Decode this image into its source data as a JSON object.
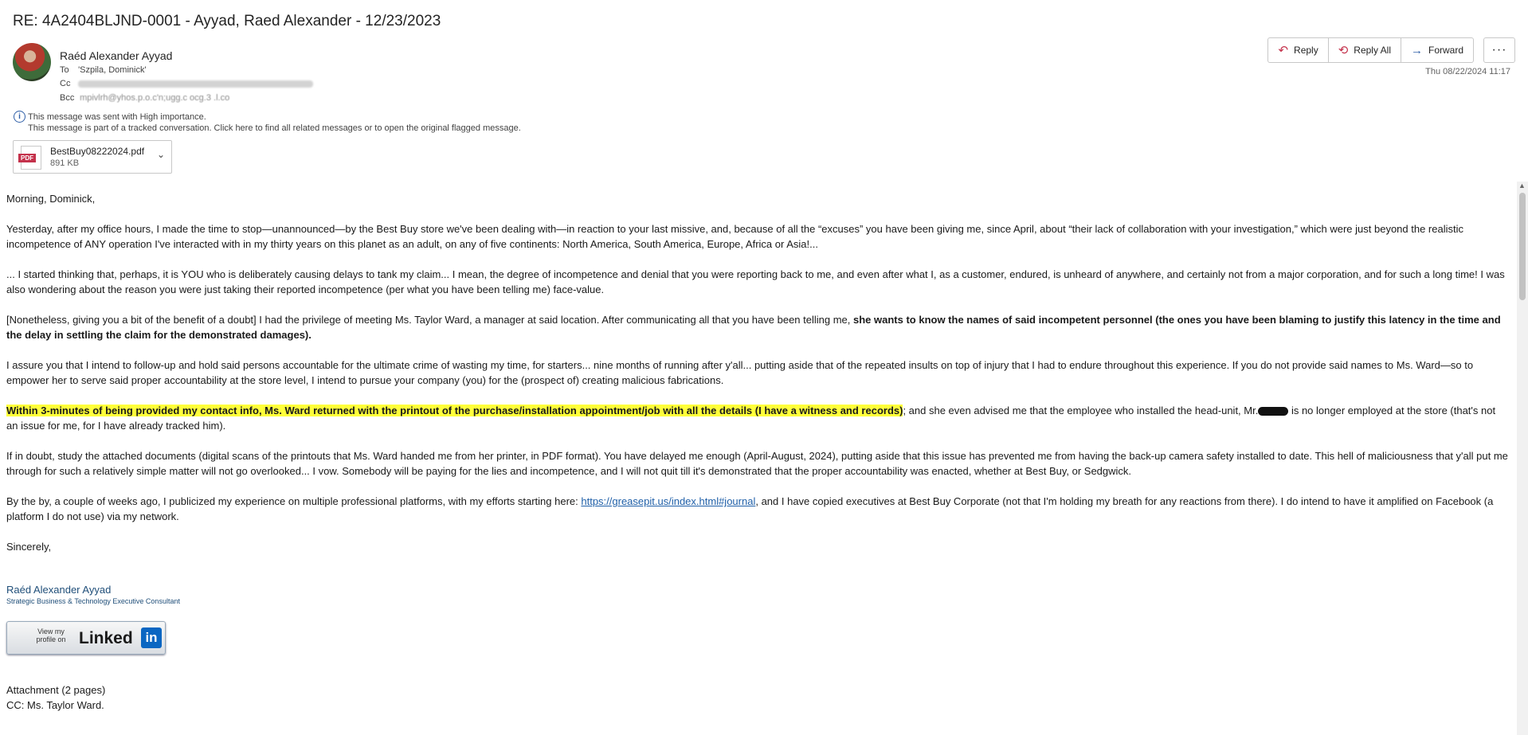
{
  "subject": "RE: 4A2404BLJND-0001 - Ayyad, Raed Alexander  - 12/23/2023",
  "sender": "Raéd Alexander Ayyad",
  "to_label": "To",
  "to_value": "'Szpila, Dominick'",
  "cc_label": "Cc",
  "bcc_label": "Bcc",
  "bcc_value": "mpivlrh@yhos.p.o.c'n;ugg.c ocg.3 .l.co",
  "actions": {
    "reply": "Reply",
    "reply_all": "Reply All",
    "forward": "Forward",
    "more": "···"
  },
  "date": "Thu 08/22/2024 11:17",
  "info_lines": [
    "This message was sent with High importance.",
    "This message is part of a tracked conversation. Click here to find all related messages or to open the original flagged message."
  ],
  "attachment": {
    "name": "BestBuy08222024.pdf",
    "size": "891 KB",
    "type_label": "PDF"
  },
  "body": {
    "greeting": "Morning, Dominick,",
    "p1": "Yesterday, after my office hours, I made the time to stop—unannounced—by the Best Buy store we've been dealing with—in reaction to your last missive, and, because of all the “excuses” you have been giving me, since April, about “their lack of collaboration with your investigation,” which were just beyond the realistic incompetence of ANY operation I've interacted with in my thirty years on this planet as an adult, on any of five continents: North America, South America, Europe, Africa or Asia!...",
    "p2": "... I started thinking that, perhaps, it is YOU who is deliberately causing delays to tank my claim... I mean, the degree of incompetence and denial that you were reporting back to me, and even after what I, as a customer, endured, is unheard of anywhere, and certainly not from a major corporation, and for such a long time! I was also wondering about the reason you were just taking their reported incompetence (per what you have been telling me) face-value.",
    "p3a": "[Nonetheless, giving you a bit of the benefit of a doubt] I had the privilege of meeting Ms. Taylor Ward, a manager at said location. After communicating all that you have been telling me, ",
    "p3b": "she wants to know the names of said incompetent personnel (the ones you have been blaming to justify this latency in the time and the delay in settling the claim for the demonstrated damages).",
    "p4": "I assure you that I intend to follow-up and hold said persons accountable for the ultimate crime of wasting my time, for starters... nine months of running after y'all... putting aside that of the repeated insults on top of injury that I had to endure throughout this experience. If you do not provide said names to Ms. Ward—so to empower her to serve said proper accountability at the store level, I intend to pursue your company (you) for the (prospect of) creating malicious fabrications.",
    "p5a": "Within 3-minutes of being provided my contact info, Ms. Ward returned with the printout of the purchase/installation appointment/job with all the details (I have a witness and records)",
    "p5b": "; and she even advised me that the employee who installed the head-unit, Mr.",
    "p5c": " is no longer employed at the store (that's not an issue for me, for I have already tracked him).",
    "p6": "If in doubt, study the attached documents (digital scans of the printouts that Ms. Ward handed me from her printer, in PDF format). You have delayed me enough (April-August, 2024), putting aside that this issue has prevented me from having the back-up camera safety installed to date. This hell of maliciousness that y'all put me through for such a relatively simple matter will not go overlooked... I vow. Somebody will be paying for the lies and incompetence, and I will not quit till it's demonstrated that the proper accountability was enacted, whether at Best Buy, or Sedgwick.",
    "p7a": "By the by, a couple of weeks ago, I publicized my experience on multiple professional platforms, with my efforts starting here: ",
    "p7_link": "https://greasepit.us/index.html#journal",
    "p7b": ", and I have copied executives at Best Buy Corporate (not that I'm holding my breath for any reactions from there). I do intend to have it amplified on Facebook (a platform I do not use) via my network.",
    "closing": "Sincerely,"
  },
  "signature": {
    "name": "Raéd Alexander Ayyad",
    "title": "Strategic Business & Technology Executive Consultant",
    "badge_small": "View my profile on",
    "badge_big": "Linked",
    "badge_in": "in"
  },
  "footer": {
    "attachment_note": "Attachment (2 pages)",
    "cc_note": "CC: Ms. Taylor Ward."
  }
}
